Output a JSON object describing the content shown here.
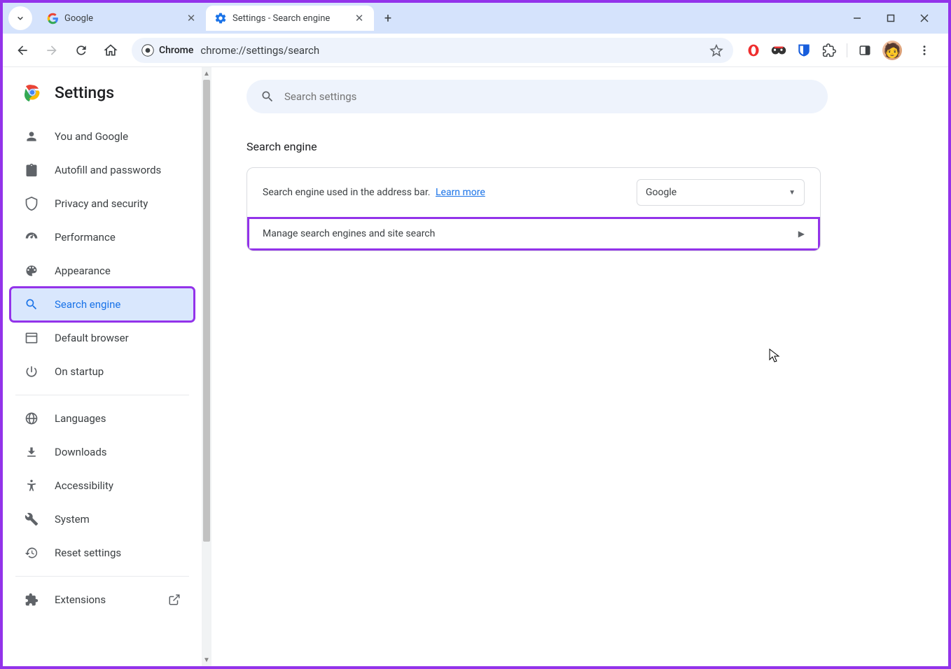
{
  "tabs": [
    {
      "title": "Google"
    },
    {
      "title": "Settings - Search engine"
    }
  ],
  "url": "chrome://settings/search",
  "chrome_label": "Chrome",
  "sidebar": {
    "title": "Settings",
    "items": [
      {
        "label": "You and Google"
      },
      {
        "label": "Autofill and passwords"
      },
      {
        "label": "Privacy and security"
      },
      {
        "label": "Performance"
      },
      {
        "label": "Appearance"
      },
      {
        "label": "Search engine"
      },
      {
        "label": "Default browser"
      },
      {
        "label": "On startup"
      }
    ],
    "items2": [
      {
        "label": "Languages"
      },
      {
        "label": "Downloads"
      },
      {
        "label": "Accessibility"
      },
      {
        "label": "System"
      },
      {
        "label": "Reset settings"
      }
    ],
    "items3": [
      {
        "label": "Extensions"
      }
    ]
  },
  "search_placeholder": "Search settings",
  "section": {
    "title": "Search engine",
    "row1_text": "Search engine used in the address bar.",
    "learn_more": "Learn more",
    "selected_engine": "Google",
    "row2_text": "Manage search engines and site search"
  }
}
